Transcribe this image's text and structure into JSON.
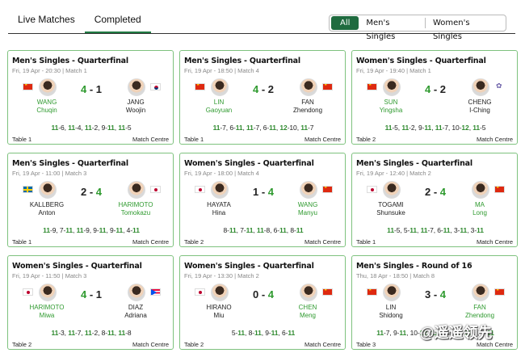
{
  "tabs": [
    {
      "label": "Live Matches"
    },
    {
      "label": "Completed"
    }
  ],
  "filter": [
    "All",
    "Men's Singles",
    "Women's Singles"
  ],
  "colors": {
    "accent": "#1f7a43",
    "winner": "#2f9a2f",
    "card_border": "#7ec27e"
  },
  "link_label": "Match Centre",
  "watermark": "@遥遥领先",
  "cards": [
    {
      "title": "Men's Singles - Quarterfinal",
      "meta": "Fri, 19 Apr - 20:30 | Match 1",
      "p1": {
        "last": "WANG",
        "first": "Chuqin",
        "flag": "chn",
        "win": true
      },
      "p2": {
        "last": "JANG",
        "first": "Woojin",
        "flag": "kor",
        "win": false
      },
      "score": [
        "4",
        "1"
      ],
      "winner": 1,
      "games": [
        [
          "11",
          "6",
          1
        ],
        [
          "11",
          "4",
          1
        ],
        [
          "11",
          "2",
          1
        ],
        [
          "9",
          "11",
          2
        ],
        [
          "11",
          "5",
          1
        ]
      ],
      "table": "Table 1"
    },
    {
      "title": "Men's Singles - Quarterfinal",
      "meta": "Fri, 19 Apr - 18:50 | Match 4",
      "p1": {
        "last": "LIN",
        "first": "Gaoyuan",
        "flag": "chn",
        "win": true
      },
      "p2": {
        "last": "FAN",
        "first": "Zhendong",
        "flag": "chn",
        "win": false
      },
      "score": [
        "4",
        "2"
      ],
      "winner": 1,
      "games": [
        [
          "11",
          "7",
          1
        ],
        [
          "6",
          "11",
          2
        ],
        [
          "11",
          "7",
          1
        ],
        [
          "6",
          "11",
          2
        ],
        [
          "12",
          "10",
          1
        ],
        [
          "11",
          "7",
          1
        ]
      ],
      "table": "Table 1"
    },
    {
      "title": "Women's Singles - Quarterfinal",
      "meta": "Fri, 19 Apr - 19:40 | Match 1",
      "p1": {
        "last": "SUN",
        "first": "Yingsha",
        "flag": "chn",
        "win": true
      },
      "p2": {
        "last": "CHENG",
        "first": "I-Ching",
        "flag": "tpe",
        "win": false
      },
      "score": [
        "4",
        "2"
      ],
      "winner": 1,
      "games": [
        [
          "11",
          "5",
          1
        ],
        [
          "11",
          "2",
          1
        ],
        [
          "9",
          "11",
          2
        ],
        [
          "11",
          "7",
          1
        ],
        [
          "10",
          "12",
          2
        ],
        [
          "11",
          "5",
          1
        ]
      ],
      "table": "Table 2"
    },
    {
      "title": "Men's Singles - Quarterfinal",
      "meta": "Fri, 19 Apr - 11:00 | Match 3",
      "p1": {
        "last": "KALLBERG",
        "first": "Anton",
        "flag": "swe",
        "win": false
      },
      "p2": {
        "last": "HARIMOTO",
        "first": "Tomokazu",
        "flag": "jpn",
        "win": true
      },
      "score": [
        "2",
        "4"
      ],
      "winner": 2,
      "games": [
        [
          "11",
          "9",
          1
        ],
        [
          "7",
          "11",
          2
        ],
        [
          "11",
          "9",
          1
        ],
        [
          "9",
          "11",
          2
        ],
        [
          "9",
          "11",
          2
        ],
        [
          "4",
          "11",
          2
        ]
      ],
      "table": "Table 1"
    },
    {
      "title": "Women's Singles - Quarterfinal",
      "meta": "Fri, 19 Apr - 18:00 | Match 4",
      "p1": {
        "last": "HAYATA",
        "first": "Hina",
        "flag": "jpn",
        "win": false
      },
      "p2": {
        "last": "WANG",
        "first": "Manyu",
        "flag": "chn",
        "win": true
      },
      "score": [
        "1",
        "4"
      ],
      "winner": 2,
      "games": [
        [
          "8",
          "11",
          2
        ],
        [
          "7",
          "11",
          2
        ],
        [
          "11",
          "8",
          1
        ],
        [
          "6",
          "11",
          2
        ],
        [
          "8",
          "11",
          2
        ]
      ],
      "table": "Table 2"
    },
    {
      "title": "Men's Singles - Quarterfinal",
      "meta": "Fri, 19 Apr - 12:40 | Match 2",
      "p1": {
        "last": "TOGAMI",
        "first": "Shunsuke",
        "flag": "jpn",
        "win": false
      },
      "p2": {
        "last": "MA",
        "first": "Long",
        "flag": "chn",
        "win": true
      },
      "score": [
        "2",
        "4"
      ],
      "winner": 2,
      "games": [
        [
          "11",
          "5",
          1
        ],
        [
          "5",
          "11",
          2
        ],
        [
          "11",
          "7",
          1
        ],
        [
          "6",
          "11",
          2
        ],
        [
          "3",
          "11",
          2
        ],
        [
          "3",
          "11",
          2
        ]
      ],
      "table": "Table 1"
    },
    {
      "title": "Women's Singles - Quarterfinal",
      "meta": "Fri, 19 Apr - 11:50 | Match 3",
      "p1": {
        "last": "HARIMOTO",
        "first": "Miwa",
        "flag": "jpn",
        "win": true
      },
      "p2": {
        "last": "DIAZ",
        "first": "Adriana",
        "flag": "pur",
        "win": false
      },
      "score": [
        "4",
        "1"
      ],
      "winner": 1,
      "games": [
        [
          "11",
          "3",
          1
        ],
        [
          "11",
          "7",
          1
        ],
        [
          "11",
          "2",
          1
        ],
        [
          "8",
          "11",
          2
        ],
        [
          "11",
          "8",
          1
        ]
      ],
      "table": "Table 2"
    },
    {
      "title": "Women's Singles - Quarterfinal",
      "meta": "Fri, 19 Apr - 13:30 | Match 2",
      "p1": {
        "last": "HIRANO",
        "first": "Miu",
        "flag": "jpn",
        "win": false
      },
      "p2": {
        "last": "CHEN",
        "first": "Meng",
        "flag": "chn",
        "win": true
      },
      "score": [
        "0",
        "4"
      ],
      "winner": 2,
      "games": [
        [
          "5",
          "11",
          2
        ],
        [
          "8",
          "11",
          2
        ],
        [
          "9",
          "11",
          2
        ],
        [
          "6",
          "11",
          2
        ]
      ],
      "table": "Table 2"
    },
    {
      "title": "Men's Singles - Round of 16",
      "meta": "Thu, 18 Apr - 18:50 | Match 8",
      "p1": {
        "last": "LIN",
        "first": "Shidong",
        "flag": "chn",
        "win": false
      },
      "p2": {
        "last": "FAN",
        "first": "Zhendong",
        "flag": "chn",
        "win": true
      },
      "score": [
        "3",
        "4"
      ],
      "winner": 2,
      "games": [
        [
          "11",
          "7",
          1
        ],
        [
          "9",
          "11",
          2
        ],
        [
          "10",
          "12",
          2
        ],
        [
          "11",
          "9",
          1
        ],
        [
          "9",
          "11",
          2
        ],
        [
          "11",
          "8",
          1
        ],
        [
          "9",
          "11",
          2
        ]
      ],
      "table": "Table 3"
    }
  ]
}
